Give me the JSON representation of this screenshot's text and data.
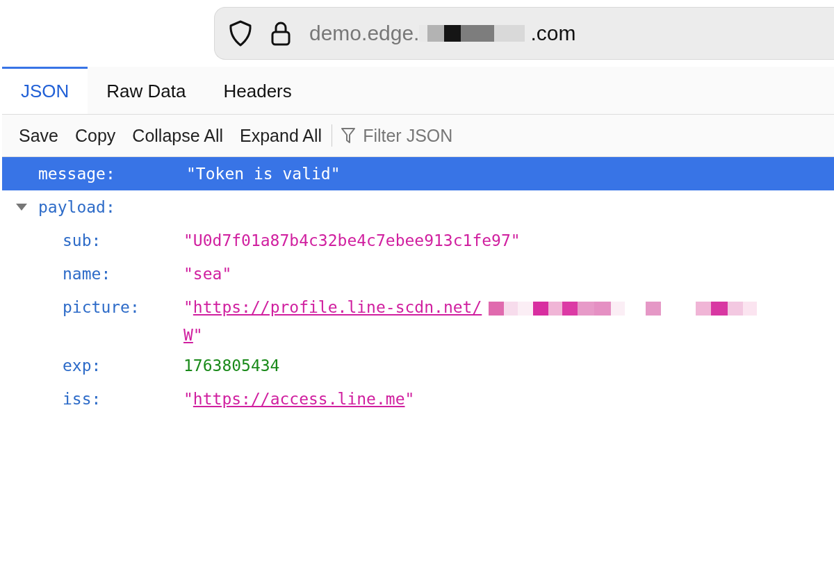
{
  "address_bar": {
    "url_start": "demo.edge.",
    "url_redacted": true,
    "url_end": ".com"
  },
  "tabs": [
    {
      "label": "JSON",
      "selected": true
    },
    {
      "label": "Raw Data",
      "selected": false
    },
    {
      "label": "Headers",
      "selected": false
    }
  ],
  "toolbar": {
    "buttons": [
      "Save",
      "Copy",
      "Collapse All",
      "Expand All"
    ],
    "filter": {
      "placeholder": "Filter JSON"
    }
  },
  "tree": [
    {
      "key": "message:",
      "kind": "string",
      "value": "\"Token is valid\"",
      "selected": true
    },
    {
      "key": "payload:",
      "kind": "object",
      "expanded": true,
      "selected": false,
      "children": [
        {
          "key": "sub:",
          "kind": "string",
          "value": "\"U0d7f01a87b4c32be4c7ebee913c1fe97\"",
          "selected": false
        },
        {
          "key": "name:",
          "kind": "string",
          "value": "\"sea\"",
          "selected": false
        },
        {
          "key": "picture:",
          "kind": "link",
          "before": "\"",
          "lines": [
            "https://profile.line-scdn.net/",
            "W"
          ],
          "after": "\"",
          "redacted": true,
          "selected": false
        },
        {
          "key": "exp:",
          "kind": "number",
          "value": "1763805434",
          "selected": false
        },
        {
          "key": "iss:",
          "kind": "link",
          "before": "\"",
          "lines": [
            "https://access.line.me"
          ],
          "after": "\"",
          "redacted": false,
          "selected": false
        }
      ]
    }
  ]
}
